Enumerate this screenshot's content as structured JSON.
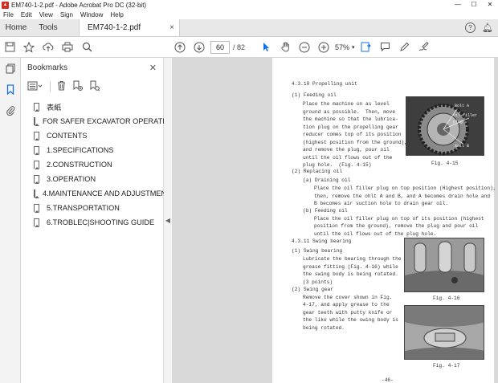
{
  "window": {
    "title": "EM740-1-2.pdf - Adobe Acrobat Pro DC (32-bit)",
    "minimize": "—",
    "maximize": "☐",
    "close": "✕"
  },
  "menu": [
    "File",
    "Edit",
    "View",
    "Sign",
    "Window",
    "Help"
  ],
  "tabs": {
    "home": "Home",
    "tools": "Tools",
    "document": "EM740-1-2.pdf",
    "close": "×",
    "help": "?"
  },
  "toolbar": {
    "page_current": "60",
    "page_total": "/ 82",
    "zoom": "57%"
  },
  "bookmarks": {
    "title": "Bookmarks",
    "close": "✕",
    "items": [
      "表紙",
      "FOR SAFER EXCAVATOR OPERATION",
      "CONTENTS",
      "1.SPECIFICATIONS",
      "2.CONSTRUCTION",
      "3.OPERATION",
      "4.MAINTENANCE AND ADJUSTMENT",
      "5.TRANSPORTATION",
      "6.TROBLEC|SHOOTING GUIDE"
    ]
  },
  "document_page": {
    "lines": [
      "4.3.10 Propelling unit",
      "(1) Feeding oil",
      "Place the machine on as level",
      "ground as possible.  Then, move",
      "the machine so that the lubrica-",
      "tion plug on the propelling gear",
      "reducer comes top of its position",
      "(highest position from the ground),",
      "and remove the plug, pour oil",
      "until the oil flows out of the",
      "plug hole.  (Fig. 4-15)",
      "(2) Replacing oil",
      "(a) Draining oil",
      "Place the oil filler plug on top position (Highest position),",
      "then, remove the ohlt A and B, and A becomes drain hole and",
      "B becomes air suction hole to drain gear oil.",
      "(b) Feeding oil",
      "Place the oil filler plug on top of its position (highest",
      "position from the ground), remove the plug and pour oil",
      "until the oil flows out of the plug hole.",
      "4.3.11 Swing bearing",
      "(1) Swing bearing",
      "Lubricate the bearing through the",
      "grease fitting (Fig. 4-16) while",
      "the swing body is being rotated.",
      "(3 points)",
      "(2) Swing gear",
      "Remove the cover shown in Fig.",
      "4-17, and apply grease to the",
      "gear teeth with putty knife or",
      "the like while the swing body is",
      "being rotated."
    ],
    "fig_labels": [
      "Fig. 4-15",
      "Fig. 4-16",
      "Fig. 4-17"
    ],
    "photo_labels": [
      "Bolt A",
      "Oil filler plug",
      "Bolt B"
    ],
    "page_number": "-46-"
  }
}
